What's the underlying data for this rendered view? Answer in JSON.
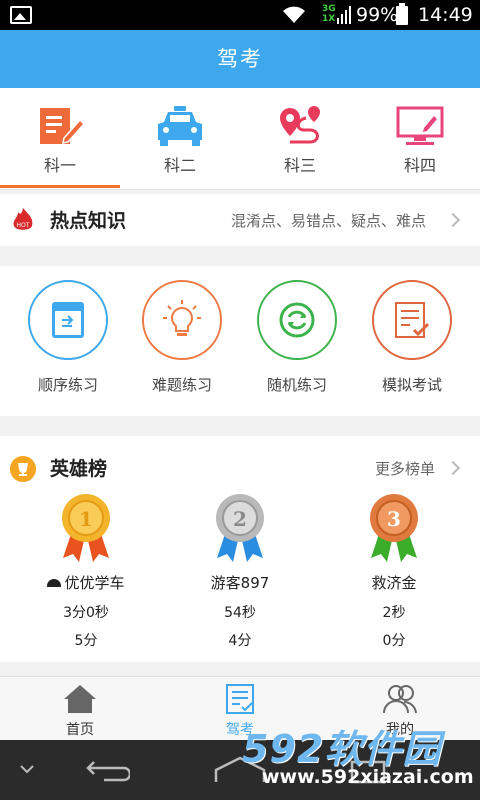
{
  "status": {
    "network": "3G\n1X",
    "battery_pct": "99%",
    "time": "14:49"
  },
  "titlebar": {
    "title": "驾考"
  },
  "subjects": {
    "items": [
      {
        "label": "科一",
        "icon": "document-edit-icon",
        "color": "#ef6a3a",
        "selected": true
      },
      {
        "label": "科二",
        "icon": "car-icon",
        "color": "#3ea8ee",
        "selected": false
      },
      {
        "label": "科三",
        "icon": "route-pin-icon",
        "color": "#e83b5b",
        "selected": false
      },
      {
        "label": "科四",
        "icon": "monitor-edit-icon",
        "color": "#e8467a",
        "selected": false
      }
    ]
  },
  "hot": {
    "title": "热点知识",
    "desc": "混淆点、易错点、疑点、难点",
    "badge": "HOT"
  },
  "practice": {
    "items": [
      {
        "label": "顺序练习",
        "icon": "calendar-icon",
        "color": "#3ea8ee"
      },
      {
        "label": "难题练习",
        "icon": "lightbulb-icon",
        "color": "#ef7a45"
      },
      {
        "label": "随机练习",
        "icon": "shuffle-icon",
        "color": "#3cb34b"
      },
      {
        "label": "模拟考试",
        "icon": "checklist-icon",
        "color": "#e0663d"
      }
    ]
  },
  "heroes": {
    "title": "英雄榜",
    "more": "更多榜单",
    "items": [
      {
        "rank": "1",
        "name": "优优学车",
        "time": "3分0秒",
        "score": "5分",
        "medal": "gold"
      },
      {
        "rank": "2",
        "name": "游客897",
        "time": "54秒",
        "score": "4分",
        "medal": "silver"
      },
      {
        "rank": "3",
        "name": "救济金",
        "time": "2秒",
        "score": "0分",
        "medal": "bronze"
      }
    ]
  },
  "tabbar": {
    "items": [
      {
        "label": "首页",
        "icon": "home-icon",
        "active": false
      },
      {
        "label": "驾考",
        "icon": "exam-list-icon",
        "active": true
      },
      {
        "label": "我的",
        "icon": "users-icon",
        "active": false
      }
    ]
  },
  "watermark": {
    "big": "592软件园",
    "small": "www.592xiazai.com"
  }
}
